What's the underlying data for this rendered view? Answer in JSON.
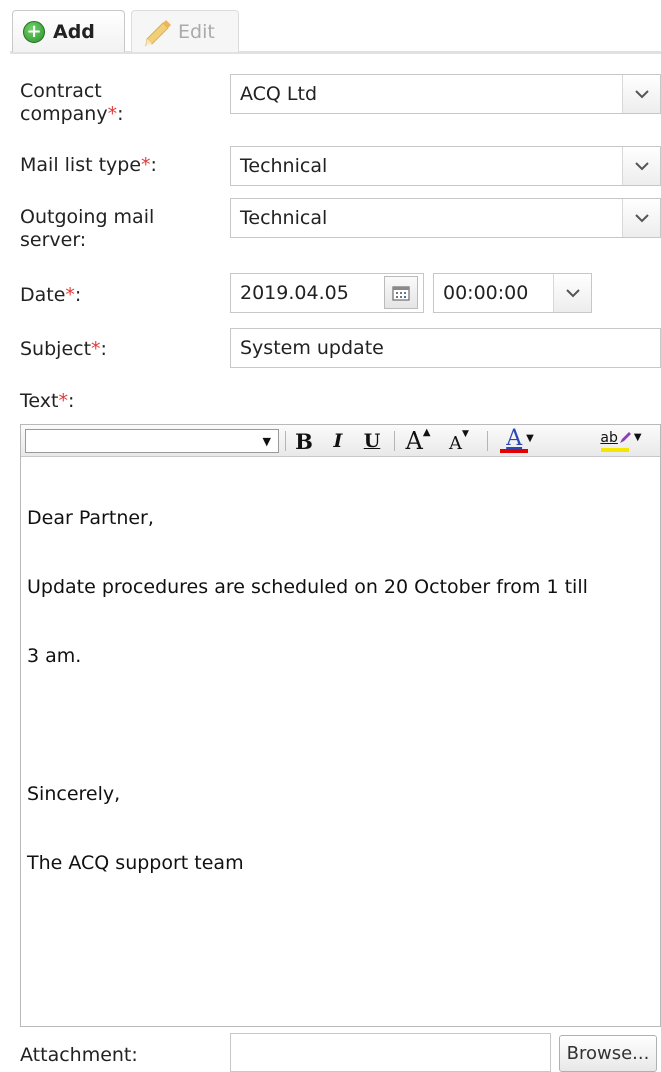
{
  "tabs": {
    "add_label": "Add",
    "edit_label": "Edit"
  },
  "form": {
    "contract_company": {
      "label_line1": "Contract",
      "label_line2": "company",
      "required": "*",
      "colon": ":",
      "value": "ACQ Ltd"
    },
    "mail_list_type": {
      "label": "Mail list type",
      "required": "*",
      "colon": ":",
      "value": "Technical"
    },
    "outgoing_mail_server": {
      "label_line1": "Outgoing mail",
      "label_line2": "server:",
      "value": "Technical"
    },
    "date": {
      "label": "Date",
      "required": "*",
      "colon": ":",
      "date_value": "2019.04.05",
      "time_value": "00:00:00"
    },
    "subject": {
      "label": "Subject",
      "required": "*",
      "colon": ":",
      "value": "System update"
    },
    "text": {
      "label": "Text",
      "required": "*",
      "colon": ":"
    },
    "attachment": {
      "label": "Attachment:",
      "value": "",
      "browse_label": "Browse..."
    }
  },
  "editor": {
    "toolbar": {
      "font_value": "",
      "bold": "B",
      "italic": "I",
      "underline": "U",
      "grow_font": "A",
      "shrink_font": "A",
      "font_color": "A",
      "highlight": "ab"
    },
    "content_lines": [
      "Dear Partner,",
      "Update procedures are scheduled on 20 October from 1 till",
      "3 am.",
      "",
      "Sincerely,",
      "The ACQ support team"
    ]
  },
  "colors": {
    "required_marker": "#e23a3a",
    "font_color_bar": "#e30000",
    "highlight_bar": "#f5e600"
  }
}
